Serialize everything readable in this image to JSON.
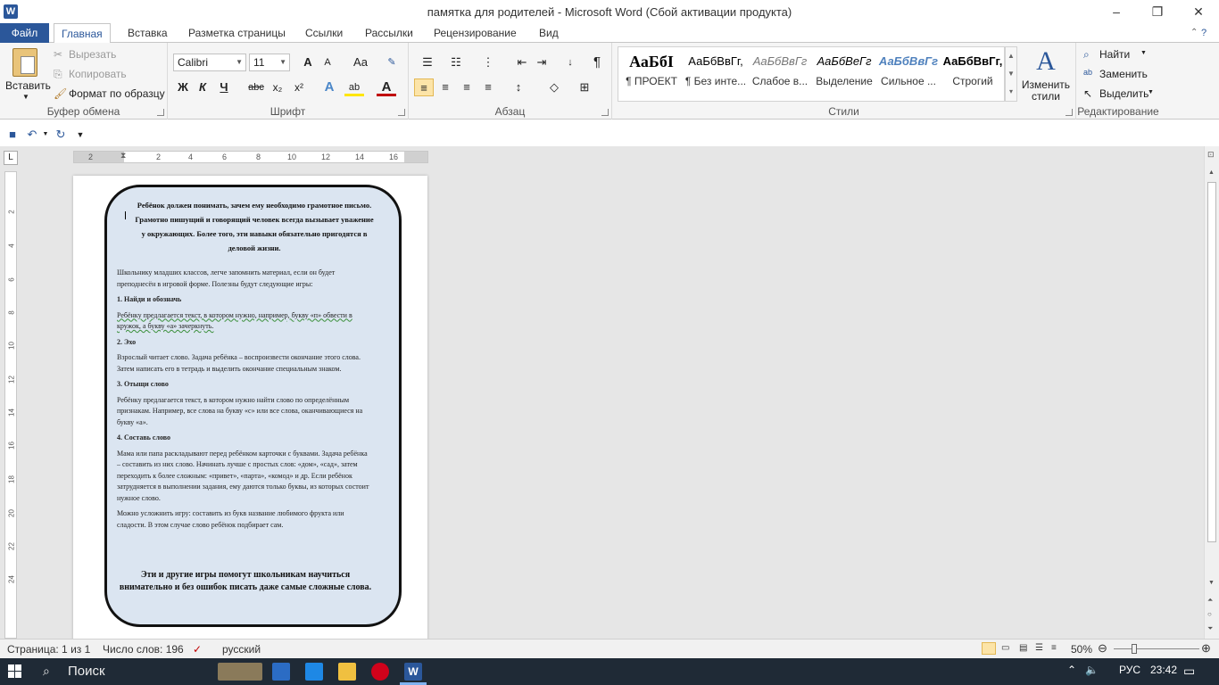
{
  "titlebar": {
    "app_icon": "W",
    "title": "памятка для родителей  -  Microsoft Word (Сбой активации продукта)",
    "minimize": "–",
    "restore": "❐",
    "close": "✕"
  },
  "tabs": [
    "Файл",
    "Главная",
    "Вставка",
    "Разметка страницы",
    "Ссылки",
    "Рассылки",
    "Рецензирование",
    "Вид"
  ],
  "ribbon": {
    "clipboard": {
      "paste": "Вставить",
      "cut": "Вырезать",
      "copy": "Копировать",
      "format_painter": "Формат по образцу",
      "label": "Буфер обмена"
    },
    "font": {
      "name": "Calibri",
      "size": "11",
      "grow": "A",
      "shrink": "A",
      "case": "Aa",
      "bold": "Ж",
      "italic": "К",
      "underline": "Ч",
      "strike": "abc",
      "subscript": "x₂",
      "superscript": "x²",
      "effects": "A",
      "highlight": "ab",
      "color": "A",
      "label": "Шрифт"
    },
    "paragraph": {
      "pilcrow": "¶",
      "label": "Абзац"
    },
    "styles": {
      "items": [
        {
          "sample": "АаБбІ",
          "name": "¶ ПРОЕКТ"
        },
        {
          "sample": "АаБбВвГг,",
          "name": "¶ Без инте..."
        },
        {
          "sample": "АаБбВвГг",
          "name": "Слабое в..."
        },
        {
          "sample": "АаБбВеГг",
          "name": "Выделение"
        },
        {
          "sample": "АаБбВвГг",
          "name": "Сильное ..."
        },
        {
          "sample": "АаБбВвГг,",
          "name": "Строгий"
        }
      ],
      "change_styles": "Изменить стили",
      "label": "Стили"
    },
    "editing": {
      "find": "Найти",
      "replace": "Заменить",
      "select": "Выделить",
      "label": "Редактирование"
    }
  },
  "ruler": {
    "h_numbers": [
      "2",
      "2",
      "4",
      "6",
      "8",
      "10",
      "12",
      "14",
      "16"
    ],
    "v_numbers": [
      "2",
      "4",
      "6",
      "8",
      "10",
      "12",
      "14",
      "16",
      "18",
      "20",
      "22",
      "24"
    ]
  },
  "document": {
    "heading": "Ребёнок должен понимать, зачем ему необходимо грамотное письмо. Грамотно пишущий и говорящий человек всегда вызывает уважение у окружающих. Более того, эти навыки обязательно пригодятся в деловой жизни.",
    "intro": "Школьнику младших классов, легче запомнить материал, если он будет преподнесён в игровой форме. Полезны будут следующие игры:",
    "game1_title": "1. Найди и обозначь",
    "game1_text": "Ребёнку предлагается текст,  в котором нужно, например, букву «п» обвести в кружок, а букву «а» зачеркнуть.",
    "game2_title": "2. Эхо",
    "game2_text": "Взрослый читает слово. Задача ребёнка – воспроизвести окончание этого слова. Затем написать  его в тетрадь и выделить окончание специальным  знаком.",
    "game3_title": "3. Отыщи слово",
    "game3_text": "Ребёнку предлагается текст,  в котором нужно найти слово по определённым признакам. Например, все слова на букву «с» или все слова, оканчивающиеся на букву «а».",
    "game4_title": "4. Составь слово",
    "game4_text": "Мама или папа раскладывают  перед ребёнком карточки с  буквами. Задача ребёнка – составить из них слово. Начинать лучше с простых слов: «дом», «сад», затем переходить к более сложным: «привет», «парта», «комод» и др. Если ребёнок затрудняется в выполнении задания, ему даются только буквы, из которых состоит нужное слово.",
    "game4_extra": "Можно усложнить игру: составить из букв название любимого фрукта или сладости. В этом случае слово ребёнок подбирает сам.",
    "footer": "Эти и другие игры помогут школьникам научиться внимательно и без ошибок писать даже самые сложные слова."
  },
  "status": {
    "page": "Страница: 1 из 1",
    "words": "Число слов: 196",
    "lang": "русский",
    "zoom": "50%"
  },
  "taskbar": {
    "search": "Поиск",
    "lang": "РУС",
    "time": "23:42"
  },
  "colors": {
    "accent": "#2b579a",
    "frame_fill": "#dbe5f1"
  }
}
